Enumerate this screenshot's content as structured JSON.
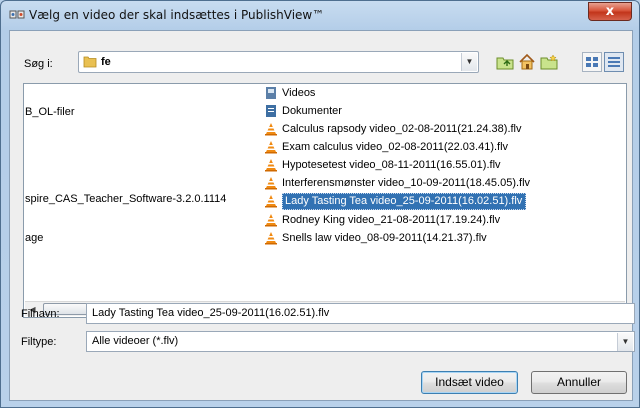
{
  "window": {
    "title": "Vælg en video der skal indsættes i PublishView™",
    "close_label": "x"
  },
  "lookin": {
    "label": "Søg i:",
    "value": "fe"
  },
  "left_column": [
    "B_OL-filer",
    "spire_CAS_Teacher_Software-3.2.0.1114",
    "age"
  ],
  "files": [
    {
      "name": "Videos",
      "icon": "library-icon",
      "selected": false
    },
    {
      "name": "Dokumenter",
      "icon": "library-icon",
      "selected": false
    },
    {
      "name": "Calculus rapsody video_02-08-2011(21.24.38).flv",
      "icon": "vlc-cone-icon",
      "selected": false
    },
    {
      "name": "Exam calculus video_02-08-2011(22.03.41).flv",
      "icon": "vlc-cone-icon",
      "selected": false
    },
    {
      "name": "Hypotesetest video_08-11-2011(16.55.01).flv",
      "icon": "vlc-cone-icon",
      "selected": false
    },
    {
      "name": "Interferensmønster video_10-09-2011(18.45.05).flv",
      "icon": "vlc-cone-icon",
      "selected": false
    },
    {
      "name": "Lady Tasting Tea video_25-09-2011(16.02.51).flv",
      "icon": "vlc-cone-icon",
      "selected": true
    },
    {
      "name": "Rodney King video_21-08-2011(17.19.24).flv",
      "icon": "vlc-cone-icon",
      "selected": false
    },
    {
      "name": "Snells law video_08-09-2011(14.21.37).flv",
      "icon": "vlc-cone-icon",
      "selected": false
    }
  ],
  "filename": {
    "label": "Filnavn:",
    "value": "Lady Tasting Tea video_25-09-2011(16.02.51).flv"
  },
  "filetype": {
    "label": "Filtype:",
    "value": "Alle videoer (*.flv)"
  },
  "buttons": {
    "insert": "Indsæt video",
    "cancel": "Annuller"
  },
  "colors": {
    "selection": "#3272b3",
    "title_bar": "#b9d1ea",
    "close": "#c2351b"
  }
}
